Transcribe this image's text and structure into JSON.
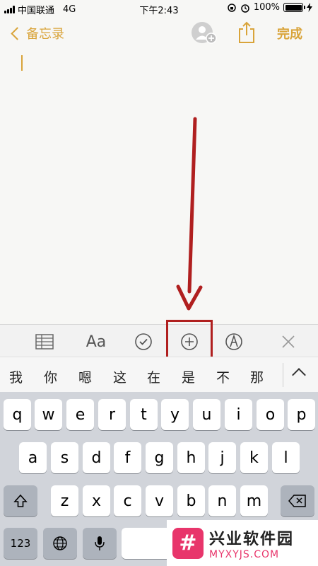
{
  "status_bar": {
    "carrier": "中国联通",
    "network": "4G",
    "time": "下午2:43",
    "battery_pct": "100%",
    "battery_level": 1.0
  },
  "nav": {
    "back_label": "备忘录",
    "done_label": "完成",
    "accent_color": "#d9a43a",
    "icons": [
      "add-people-icon",
      "share-icon"
    ]
  },
  "note": {
    "body": ""
  },
  "toolbar": {
    "items": [
      "table-icon",
      "Aa",
      "checklist-icon",
      "add-attachment-icon",
      "markup-icon",
      "close-icon"
    ],
    "format_label": "Aa",
    "highlighted": "add-attachment-icon"
  },
  "candidates": {
    "items": [
      "我",
      "你",
      "嗯",
      "这",
      "在",
      "是",
      "不",
      "那"
    ]
  },
  "keyboard": {
    "row1": [
      "q",
      "w",
      "e",
      "r",
      "t",
      "y",
      "u",
      "i",
      "o",
      "p"
    ],
    "row2": [
      "a",
      "s",
      "d",
      "f",
      "g",
      "h",
      "j",
      "k",
      "l"
    ],
    "row3": [
      "z",
      "x",
      "c",
      "v",
      "b",
      "n",
      "m"
    ],
    "numbers_label": "123"
  },
  "watermark": {
    "title": "兴业软件园",
    "url": "MYXYJS.COM",
    "logo_glyph": "#"
  },
  "annotation_color": "#b01f1f"
}
